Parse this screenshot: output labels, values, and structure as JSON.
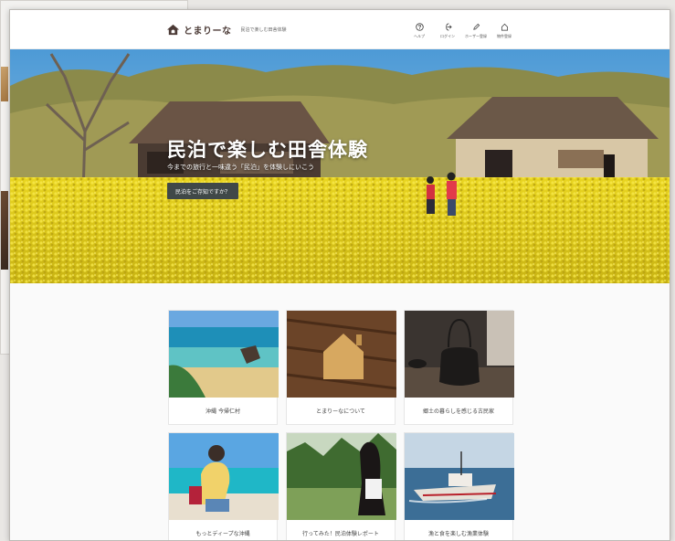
{
  "site": {
    "logo_text": "とまりーな",
    "tagline": "民泊で楽しむ田舎体験"
  },
  "nav": [
    {
      "label": "ヘルプ",
      "icon": "help-icon"
    },
    {
      "label": "ログイン",
      "icon": "login-icon"
    },
    {
      "label": "ホーザー登録",
      "icon": "pencil-icon"
    },
    {
      "label": "物件登録",
      "icon": "home-icon"
    }
  ],
  "hero": {
    "title": "民泊で楽しむ田舎体験",
    "subtitle": "今までの旅行と一味違う「民泊」を体験しにいこう",
    "button_label": "民泊をご存知ですか？"
  },
  "cards": [
    {
      "caption": "沖縄 今帰仁村"
    },
    {
      "caption": "とまりーなについて"
    },
    {
      "caption": "郷土の暮らしを感じる古民家"
    },
    {
      "caption": "もっとディープな沖縄"
    },
    {
      "caption": "行ってみた！民泊体験レポート"
    },
    {
      "caption": "漁と食を楽しむ漁業体験"
    }
  ],
  "colors": {
    "button_bg": "#404848",
    "logo_text": "#4b3a36",
    "rapeseed": "#f2dc2a"
  }
}
